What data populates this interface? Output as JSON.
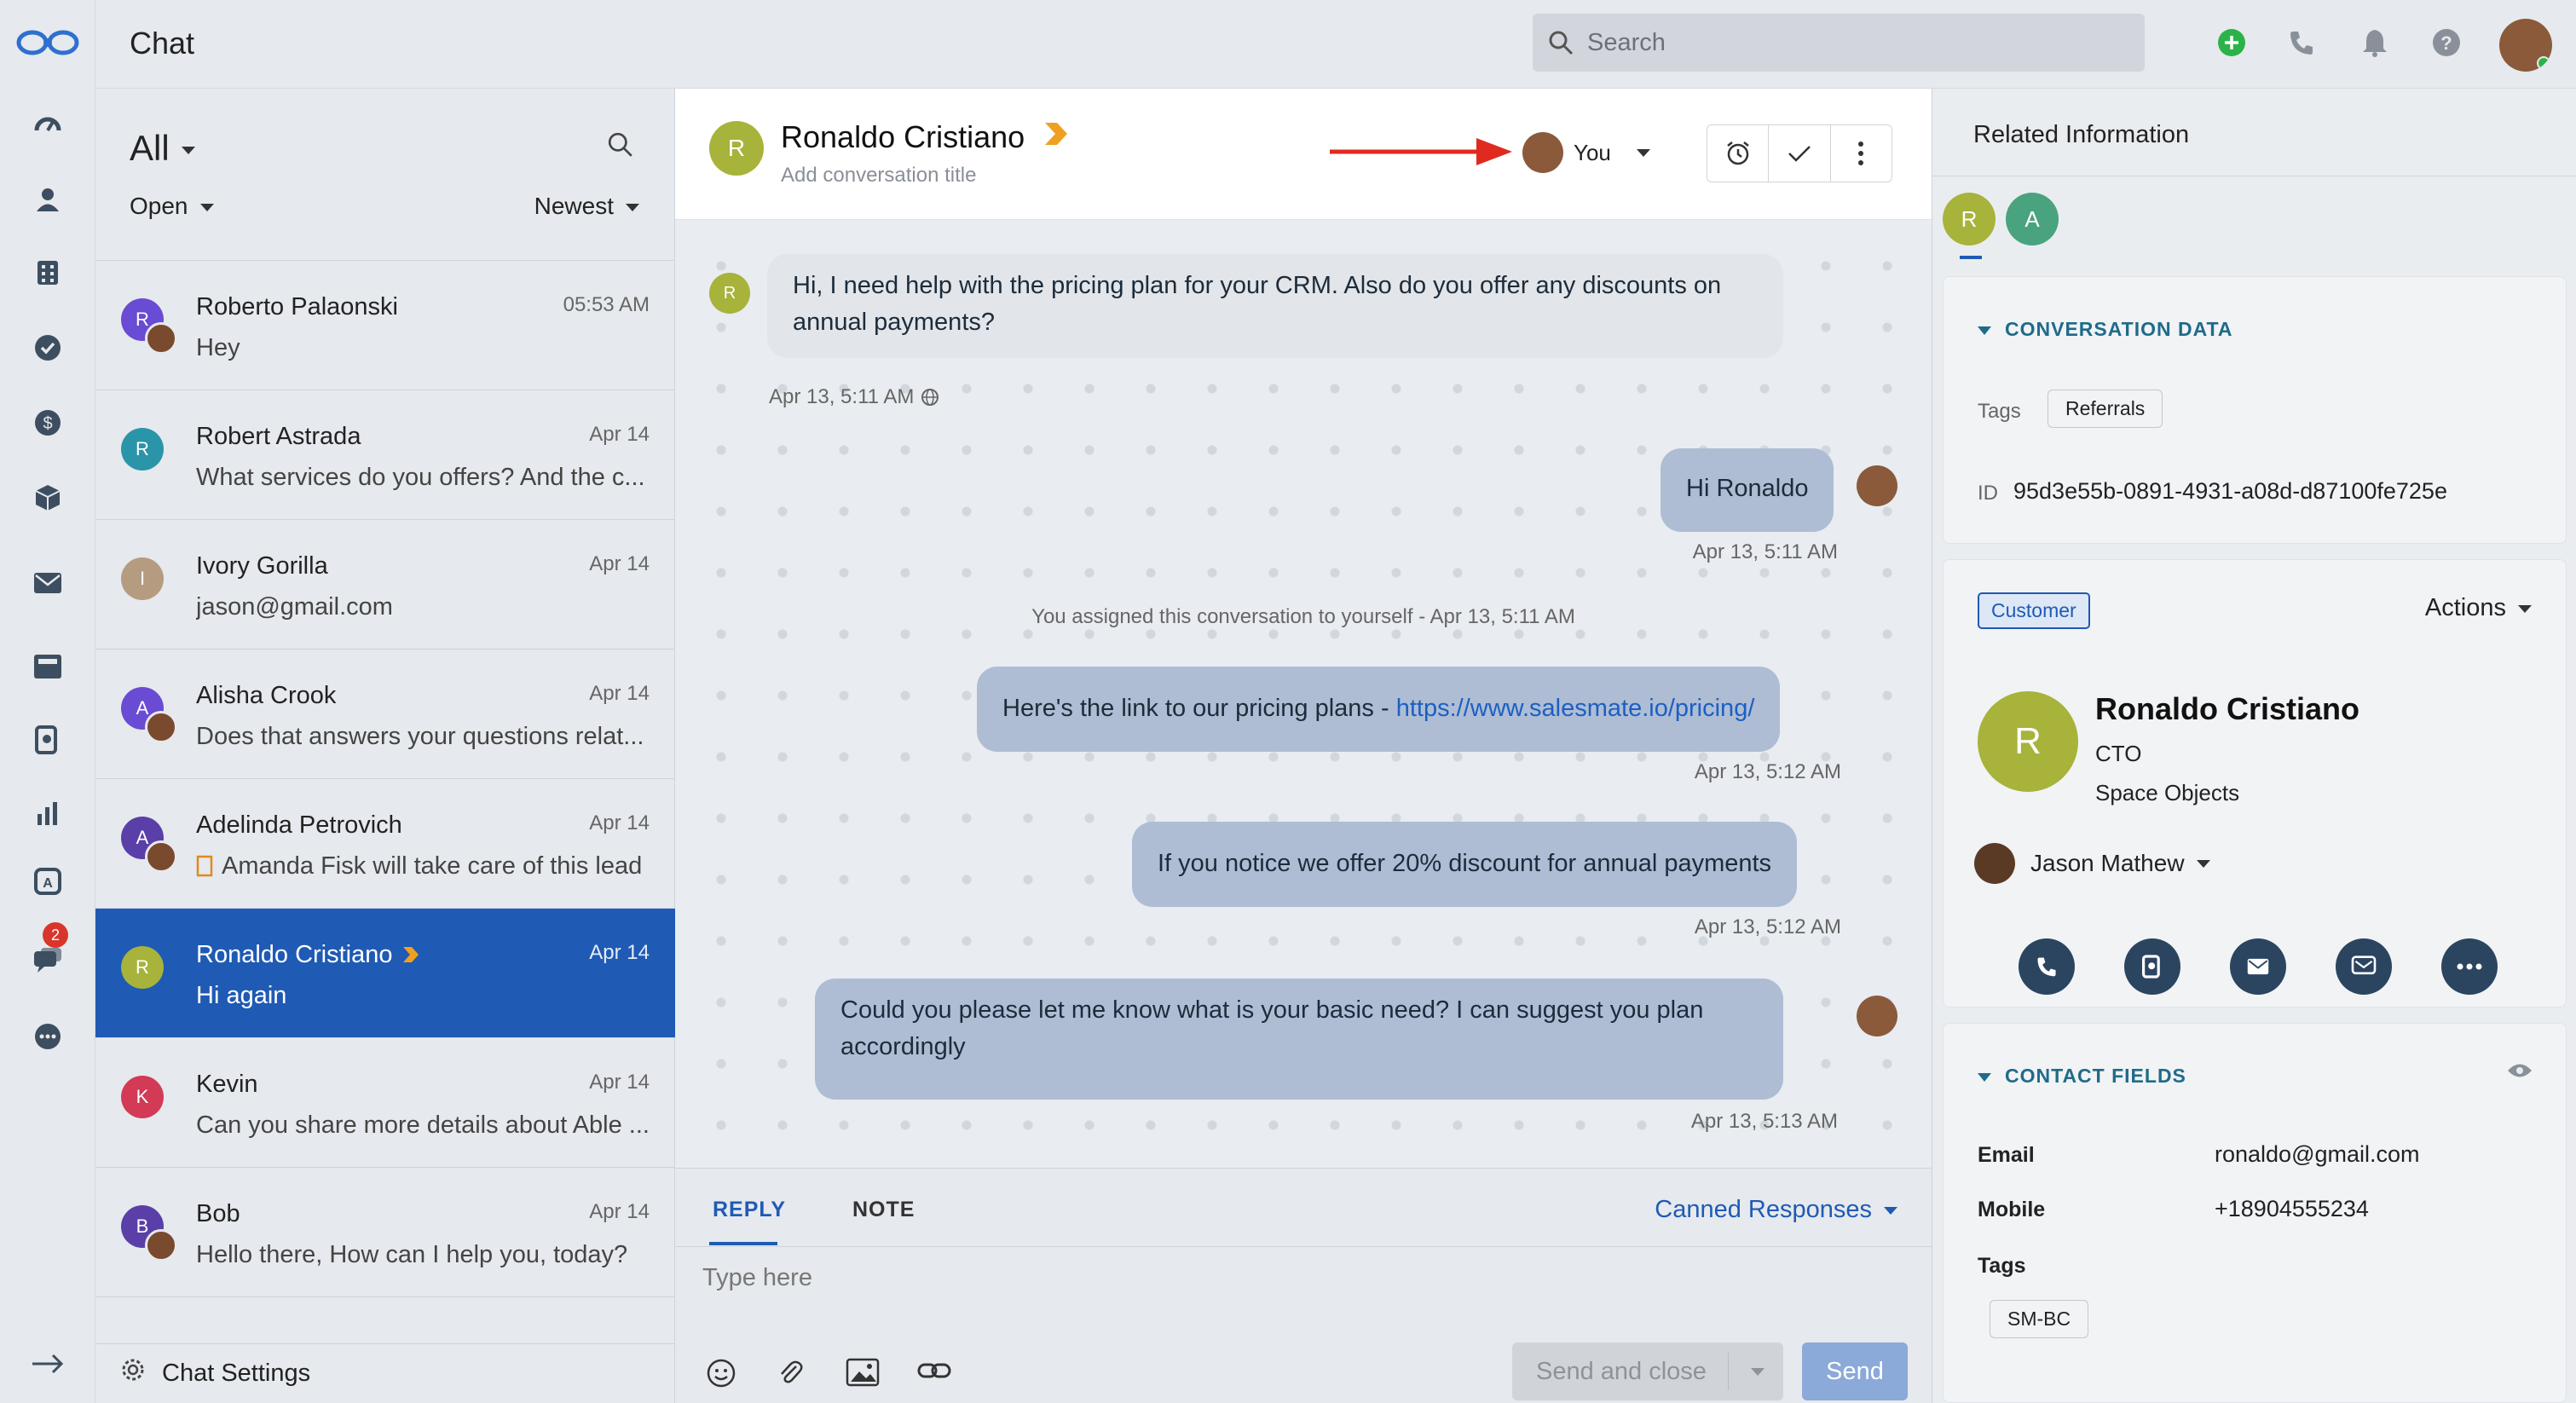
{
  "topbar": {
    "title": "Chat",
    "search_placeholder": "Search"
  },
  "rail": {
    "badge_count": "2"
  },
  "list": {
    "filter_all": "All",
    "filter_status": "Open",
    "sort": "Newest",
    "items": [
      {
        "name": "Roberto Palaonski",
        "time": "05:53 AM",
        "preview": "Hey",
        "initial": "R",
        "color": "#6a4bd3",
        "has_agent": true
      },
      {
        "name": "Robert Astrada",
        "time": "Apr 14",
        "preview": "What services do you offers? And the c...",
        "initial": "R",
        "color": "#2a95a8",
        "has_agent": false
      },
      {
        "name": "Ivory Gorilla",
        "time": "Apr 14",
        "preview": "jason@gmail.com",
        "initial": "I",
        "color": "#b59b80",
        "has_agent": false
      },
      {
        "name": "Alisha Crook",
        "time": "Apr 14",
        "preview": "Does that answers your questions relat...",
        "initial": "A",
        "color": "#6a4bd3",
        "has_agent": true
      },
      {
        "name": "Adelinda Petrovich",
        "time": "Apr 14",
        "preview": "Amanda Fisk will take care of this lead",
        "initial": "A",
        "color": "#5a3fa8",
        "has_agent": true
      },
      {
        "name": "Ronaldo Cristiano",
        "time": "Apr 14",
        "preview": "Hi again",
        "initial": "R",
        "color": "#a7b33a",
        "has_agent": false
      },
      {
        "name": "Kevin",
        "time": "Apr 14",
        "preview": "Can you share more details about Able ...",
        "initial": "K",
        "color": "#d23a55",
        "has_agent": false
      },
      {
        "name": "Bob",
        "time": "Apr 14",
        "preview": "Hello there, How can I help you, today?",
        "initial": "B",
        "color": "#5a3fa8",
        "has_agent": true
      }
    ],
    "settings_label": "Chat Settings"
  },
  "chat": {
    "contact_name": "Ronaldo Cristiano",
    "contact_initial": "R",
    "subtitle": "Add conversation title",
    "assignee": "You",
    "messages": {
      "m1": {
        "text": "Hi, I need help with the pricing plan for your CRM. Also do you offer any discounts on annual payments?",
        "time": "Apr 13, 5:11 AM"
      },
      "m2": {
        "text": "Hi Ronaldo",
        "time": "Apr 13, 5:11 AM"
      },
      "sys": "You assigned this conversation to yourself - Apr 13, 5:11 AM",
      "m3": {
        "text": "Here's the link to our pricing plans - ",
        "link": "https://www.salesmate.io/pricing/",
        "time": "Apr 13, 5:12 AM"
      },
      "m4": {
        "text": "If you notice we offer 20% discount for annual payments",
        "time": "Apr 13, 5:12 AM"
      },
      "m5": {
        "text": "Could you please let me know what is your basic need? I can suggest you plan accordingly",
        "time": "Apr 13, 5:13 AM"
      }
    }
  },
  "composer": {
    "tab_reply": "REPLY",
    "tab_note": "NOTE",
    "canned": "Canned Responses",
    "placeholder": "Type here",
    "send_close": "Send and close",
    "send": "Send"
  },
  "related": {
    "title": "Related Information",
    "avatars": [
      "R",
      "A"
    ],
    "conv_data": {
      "title": "CONVERSATION DATA",
      "tags_label": "Tags",
      "tag": "Referrals",
      "id_label": "ID",
      "id_value": "95d3e55b-0891-4931-a08d-d87100fe725e"
    },
    "contact": {
      "badge": "Customer",
      "actions": "Actions",
      "initial": "R",
      "name": "Ronaldo Cristiano",
      "role": "CTO",
      "company": "Space Objects",
      "owner": "Jason Mathew"
    },
    "fields": {
      "title": "CONTACT FIELDS",
      "email_label": "Email",
      "email": "ronaldo@gmail.com",
      "mobile_label": "Mobile",
      "mobile": "+18904555234",
      "tags_label": "Tags",
      "tag": "SM-BC"
    }
  },
  "colors": {
    "accent": "#1f5ab4",
    "selected_row": "#1f5ab4",
    "outgoing_bubble": "#aebdd4",
    "incoming_bubble": "#e2e5e9",
    "contact_avatar": "#a7b33a",
    "teal_heading": "#1f6b8a"
  }
}
